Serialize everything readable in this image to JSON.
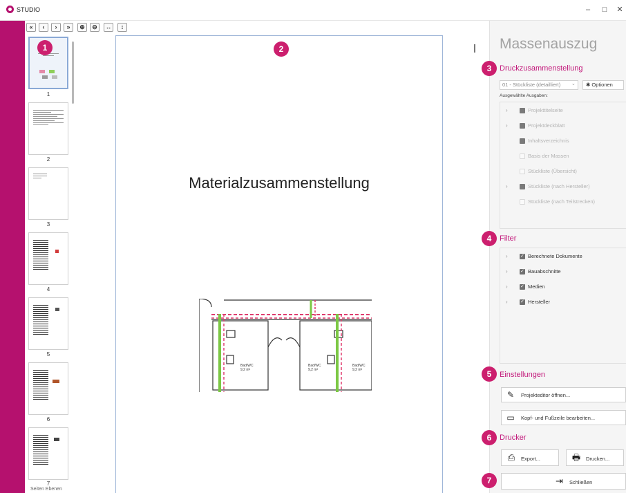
{
  "window": {
    "title": "STUDIO",
    "minimize": "–",
    "maximize": "□",
    "close": "✕"
  },
  "toolbar": {
    "buttons": [
      "«",
      "‹",
      "›",
      "»",
      "⊕",
      "⊖",
      "↔",
      "↕"
    ]
  },
  "thumbnails": {
    "pages": [
      "1",
      "2",
      "3",
      "4",
      "5",
      "6",
      "7"
    ],
    "bottom_tabs": "Seiten  Ebenen"
  },
  "document": {
    "page_title": "Materialzusammenstellung",
    "plan_labels": [
      "Bad/WC",
      "9,2 m²",
      "Bad/WC",
      "9,2 m²",
      "Bad/WC",
      "9,2 m²"
    ]
  },
  "badges": [
    "1",
    "2",
    "3",
    "4",
    "5",
    "6",
    "7"
  ],
  "panel": {
    "title": "Massenauszug",
    "sections": {
      "print": "Druckzusammenstellung",
      "filter": "Filter",
      "settings": "Einstellungen",
      "printer": "Drucker"
    },
    "select_value": "01 - Stückliste (detailliert)",
    "options_label": "Optionen",
    "selected_outputs_label": "Ausgewählte Ausgaben:",
    "outputs": [
      {
        "label": "Projekttitelseite",
        "expandable": true,
        "checkbox": "fill"
      },
      {
        "label": "Projektdeckblatt",
        "expandable": true,
        "checkbox": "fill"
      },
      {
        "label": "Inhaltsverzeichnis",
        "expandable": false,
        "checkbox": "fill"
      },
      {
        "label": "Basis der Massen",
        "expandable": false,
        "checkbox": "empty"
      },
      {
        "label": "Stückliste (Übersicht)",
        "expandable": false,
        "checkbox": "empty"
      },
      {
        "label": "Stückliste (nach Hersteller)",
        "expandable": true,
        "checkbox": "fill"
      },
      {
        "label": "Stückliste (nach Teilstrecken)",
        "expandable": false,
        "checkbox": "empty"
      }
    ],
    "filters": [
      {
        "label": "Berechnete Dokumente",
        "checked": true
      },
      {
        "label": "Bauabschnitte",
        "checked": true
      },
      {
        "label": "Medien",
        "checked": true
      },
      {
        "label": "Hersteller",
        "checked": true
      }
    ],
    "settings_buttons": {
      "editor": "Projekteditor öffnen...",
      "header_footer": "Kopf- und Fußzeile bearbeiten..."
    },
    "printer_buttons": {
      "export": "Export...",
      "print": "Drucken..."
    },
    "close_label": "Schließen"
  },
  "colors": {
    "accent": "#b5116e",
    "badge": "#cc1f6e",
    "section_heading": "#c2187a"
  }
}
